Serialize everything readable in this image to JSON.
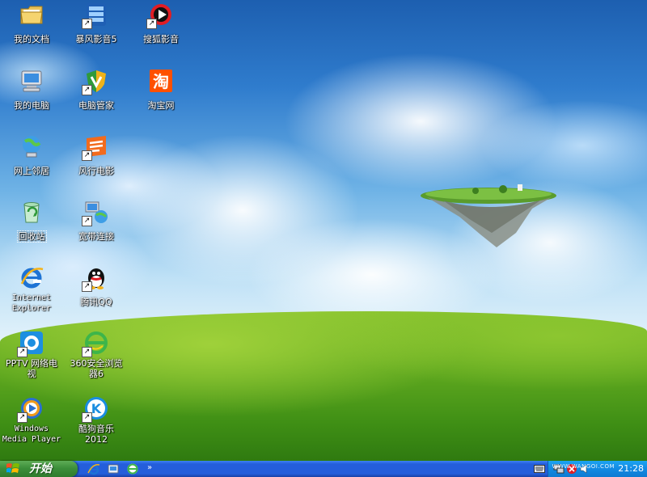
{
  "desktop": {
    "icons": [
      {
        "label": "我的文档",
        "icon": "my-documents-folder-icon"
      },
      {
        "label": "暴风影音5",
        "icon": "baofeng-player-icon"
      },
      {
        "label": "搜狐影音",
        "icon": "sohu-video-icon"
      },
      {
        "label": "我的电脑",
        "icon": "my-computer-icon"
      },
      {
        "label": "电脑管家",
        "icon": "pc-manager-shield-icon"
      },
      {
        "label": "淘宝网",
        "icon": "taobao-icon"
      },
      {
        "label": "网上邻居",
        "icon": "network-places-icon"
      },
      {
        "label": "风行电影",
        "icon": "funshion-icon"
      },
      {
        "label": "回收站",
        "icon": "recycle-bin-icon"
      },
      {
        "label": "宽带连接",
        "icon": "broadband-connection-icon"
      },
      {
        "label": "Internet\nExplorer",
        "icon": "internet-explorer-icon"
      },
      {
        "label": "腾讯QQ",
        "icon": "qq-penguin-icon"
      },
      {
        "label": "PPTV 网络电\n视",
        "icon": "pptv-icon"
      },
      {
        "label": "360安全浏览\n器6",
        "icon": "360-browser-icon"
      },
      {
        "label": "Windows\nMedia Player",
        "icon": "windows-media-player-icon"
      },
      {
        "label": "酷狗音乐\n2012",
        "icon": "kugou-music-icon"
      }
    ]
  },
  "taskbar": {
    "start_label": "开始",
    "quick_launch": [
      {
        "icon": "internet-explorer-icon"
      },
      {
        "icon": "show-desktop-icon"
      },
      {
        "icon": "360-browser-icon"
      }
    ],
    "more_label": "»",
    "clock": "21:28",
    "watermark": "WWW.WANGOI.COM"
  },
  "colors": {
    "taskbar_blue": "#245edb",
    "start_green": "#3c8f3a",
    "tray_blue": "#128ae3"
  }
}
